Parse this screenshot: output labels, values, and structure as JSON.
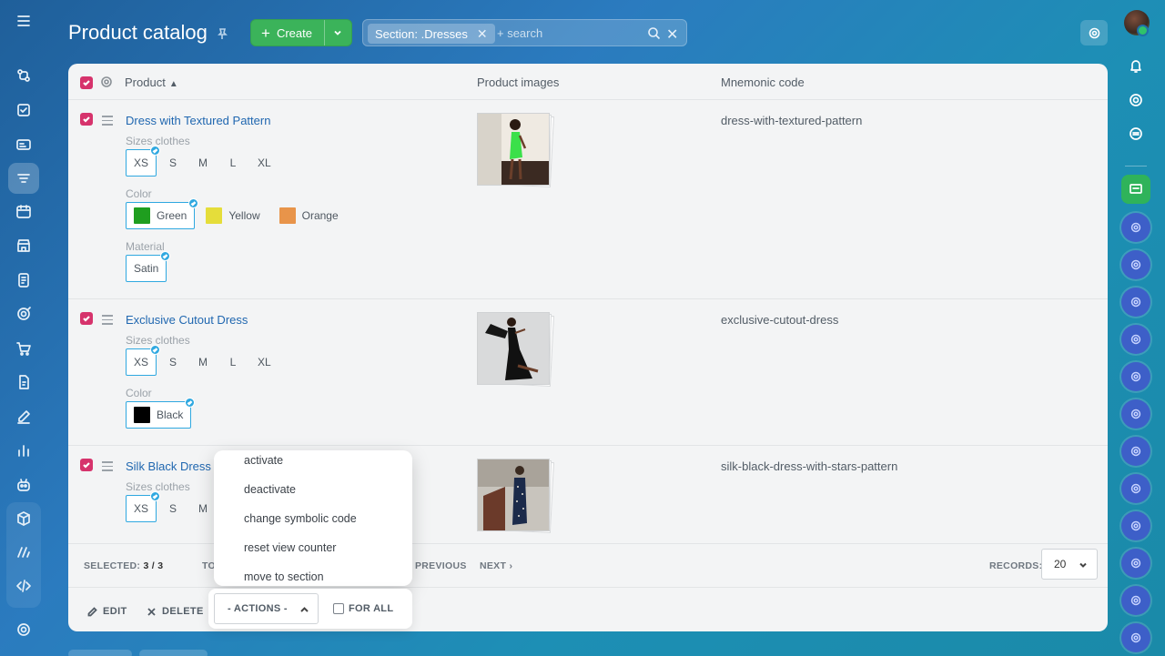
{
  "header": {
    "title": "Product catalog",
    "create_label": "Create",
    "filter_tag": "Section: .Dresses",
    "search_placeholder": "+ search"
  },
  "grid": {
    "columns": [
      "Product",
      "Product images",
      "Mnemonic code"
    ],
    "rows": [
      {
        "name": "Dress with Textured Pattern",
        "code": "dress-with-textured-pattern",
        "sizes_label": "Sizes clothes",
        "sizes": [
          "XS",
          "S",
          "M",
          "L",
          "XL"
        ],
        "color_label": "Color",
        "colors": [
          "Green",
          "Yellow",
          "Orange"
        ],
        "material_label": "Material",
        "materials": [
          "Satin"
        ]
      },
      {
        "name": "Exclusive Cutout Dress",
        "code": "exclusive-cutout-dress",
        "sizes_label": "Sizes clothes",
        "sizes": [
          "XS",
          "S",
          "M",
          "L",
          "XL"
        ],
        "color_label": "Color",
        "colors": [
          "Black"
        ]
      },
      {
        "name": "Silk Black Dress",
        "code": "silk-black-dress-with-stars-pattern",
        "sizes_label": "Sizes clothes",
        "sizes": [
          "XS",
          "S",
          "M"
        ]
      }
    ],
    "swatch_colors": {
      "Green": "#1f9e1f",
      "Yellow": "#e5dd3a",
      "Orange": "#e8944a",
      "Black": "#000000"
    }
  },
  "footer": {
    "selected_label": "SELECTED:",
    "selected_value": "3 / 3",
    "total_label": "TO",
    "previous": "PREVIOUS",
    "next": "NEXT",
    "records_label": "RECORDS:",
    "records_value": "20",
    "edit": "EDIT",
    "delete": "DELETE",
    "actions": "- ACTIONS -",
    "for_all": "FOR ALL"
  },
  "actions_menu": [
    "activate",
    "deactivate",
    "change symbolic code",
    "reset view counter",
    "move to section"
  ],
  "colors": {
    "accent_check": "#d6336c",
    "link": "#2067b0",
    "create": "#3bb35a",
    "selected_chip": "#2fa8e0"
  }
}
